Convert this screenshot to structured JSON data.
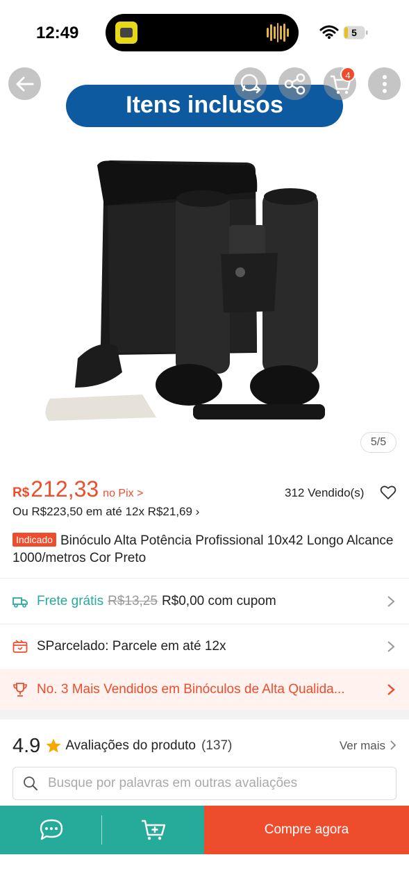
{
  "status_bar": {
    "time": "12:49",
    "battery_level": "5",
    "icons": [
      "app-notification-icon",
      "audio-wave-icon",
      "wifi-icon",
      "battery-icon"
    ]
  },
  "header": {
    "buttons": [
      "back-arrow-icon",
      "whatsapp-share-icon",
      "share-icon",
      "cart-icon",
      "more-icon"
    ],
    "cart_badge": "4"
  },
  "gallery": {
    "banner_text": "Itens inclusos",
    "counter": "5/5"
  },
  "price": {
    "currency": "R$",
    "value": "212,33",
    "pix_label": "no Pix >",
    "sold": "312 Vendido(s)",
    "installment": "Ou R$223,50 em até 12x R$21,69 ›"
  },
  "product": {
    "tag": "Indicado",
    "title": "Binóculo Alta Potência Profissional 10x42 Longo Alcance 1000/metros Cor Preto"
  },
  "shipping": {
    "label": "Frete grátis",
    "old_price": "R$13,25",
    "coupon_text": "R$0,00 com cupom"
  },
  "installments_row": {
    "text": "SParcelado: Parcele em até 12x"
  },
  "ranking": {
    "text": "No. 3 Mais Vendidos em Binóculos de Alta Qualida..."
  },
  "reviews": {
    "score": "4.9",
    "title": "Avaliações do produto",
    "count": "(137)",
    "see_more": "Ver mais",
    "search_placeholder": "Busque por palavras em outras avaliações"
  },
  "bottom_bar": {
    "chat_icon": "chat-icon",
    "add_to_cart_icon": "add-to-cart-icon",
    "buy_now": "Compre agora"
  },
  "colors": {
    "accent": "#ee4d2d",
    "teal": "#26aa99",
    "banner_blue": "#0d5aa0"
  }
}
